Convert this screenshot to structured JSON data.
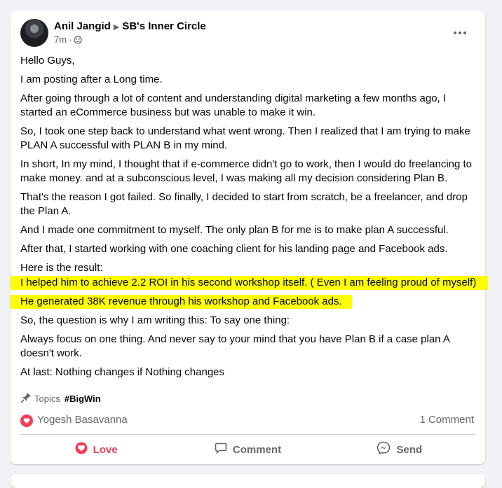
{
  "post": {
    "author": "Anil Jangid",
    "group": "SB's Inner Circle",
    "time": "7m",
    "separator": "·",
    "paragraphs": [
      "Hello Guys,",
      "I am posting after a Long time.",
      "After going through a lot of content and understanding digital marketing a few months ago, I started an eCommerce business but was unable to make it win.",
      "So, I took one step back to understand what went wrong. Then I realized that I am trying to make PLAN A successful with PLAN B in my mind.",
      "In short, In my mind, I thought that if e-commerce didn't go to work, then I would do freelancing to make money. and at a subconscious level, I was making all my decision considering Plan B.",
      "That's the reason I got failed. So finally, I decided to start from scratch, be a freelancer, and drop the Plan A.",
      "And I made one commitment to myself. The only plan B for me is to make plan A successful.",
      "After that, I started working with one coaching client for his landing page and Facebook ads.",
      "Here is the result:"
    ],
    "highlights": [
      "I helped him to achieve 2.2 ROI in his second workshop itself. ( Even I am feeling proud of myself)",
      "He generated 38K revenue through his workshop and Facebook ads."
    ],
    "closing": [
      "So, the question is why I am writing this: To say one thing:",
      "Always focus on one thing. And never say to your mind that you have Plan B if a case plan A doesn't work.",
      "At last: Nothing changes if Nothing changes"
    ],
    "highlight_color": "#ffff00"
  },
  "topics": {
    "label": "Topics",
    "tag": "#BigWin"
  },
  "reactions": {
    "reactor": "Yogesh Basavanna",
    "comment_count": "1 Comment"
  },
  "actions": {
    "love": "Love",
    "comment": "Comment",
    "send": "Send"
  },
  "colors": {
    "love": "#f33e58",
    "muted": "#65676b"
  }
}
